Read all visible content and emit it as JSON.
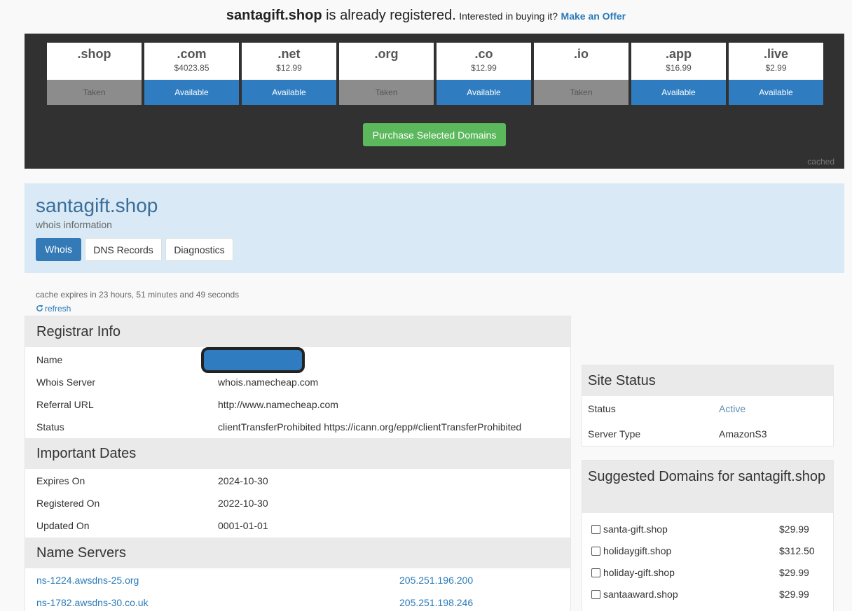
{
  "banner": {
    "domain": "santagift.shop",
    "registered_text": " is already registered.",
    "interested_text": "Interested in buying it?",
    "offer_link": "Make an Offer"
  },
  "tlds": [
    {
      "name": ".shop",
      "price": "",
      "status": "Taken"
    },
    {
      "name": ".com",
      "price": "$4023.85",
      "status": "Available"
    },
    {
      "name": ".net",
      "price": "$12.99",
      "status": "Available"
    },
    {
      "name": ".org",
      "price": "",
      "status": "Taken"
    },
    {
      "name": ".co",
      "price": "$12.99",
      "status": "Available"
    },
    {
      "name": ".io",
      "price": "",
      "status": "Taken"
    },
    {
      "name": ".app",
      "price": "$16.99",
      "status": "Available"
    },
    {
      "name": ".live",
      "price": "$2.99",
      "status": "Available"
    }
  ],
  "purchase_button": "Purchase Selected Domains",
  "cached_label": "cached",
  "header": {
    "title": "santagift.shop",
    "subtitle": "whois information",
    "tabs": [
      "Whois",
      "DNS Records",
      "Diagnostics"
    ]
  },
  "cache": {
    "text": "cache expires in 23 hours, 51 minutes and 49 seconds",
    "refresh": "refresh"
  },
  "registrar": {
    "title": "Registrar Info",
    "rows": [
      {
        "label": "Name",
        "value": ""
      },
      {
        "label": "Whois Server",
        "value": "whois.namecheap.com"
      },
      {
        "label": "Referral URL",
        "value": "http://www.namecheap.com"
      },
      {
        "label": "Status",
        "value": "clientTransferProhibited https://icann.org/epp#clientTransferProhibited"
      }
    ]
  },
  "dates": {
    "title": "Important Dates",
    "rows": [
      {
        "label": "Expires On",
        "value": "2024-10-30"
      },
      {
        "label": "Registered On",
        "value": "2022-10-30"
      },
      {
        "label": "Updated On",
        "value": "0001-01-01"
      }
    ]
  },
  "nameservers": {
    "title": "Name Servers",
    "rows": [
      {
        "host": "ns-1224.awsdns-25.org",
        "ip": "205.251.196.200"
      },
      {
        "host": "ns-1782.awsdns-30.co.uk",
        "ip": "205.251.198.246"
      }
    ]
  },
  "site_status": {
    "title": "Site Status",
    "rows": [
      {
        "label": "Status",
        "value": "Active"
      },
      {
        "label": "Server Type",
        "value": "AmazonS3"
      }
    ]
  },
  "suggested": {
    "title": "Suggested Domains for santagift.shop",
    "items": [
      {
        "name": "santa-gift.shop",
        "price": "$29.99"
      },
      {
        "name": "holidaygift.shop",
        "price": "$312.50"
      },
      {
        "name": "holiday-gift.shop",
        "price": "$29.99"
      },
      {
        "name": "santaaward.shop",
        "price": "$29.99"
      }
    ]
  },
  "colors": {
    "available": "#2f7dc0",
    "taken": "#8c8c8c",
    "purchase": "#5cb85c",
    "panel_dark": "#313131",
    "header_bg": "#d9eaf6",
    "link": "#2a7ab8"
  }
}
